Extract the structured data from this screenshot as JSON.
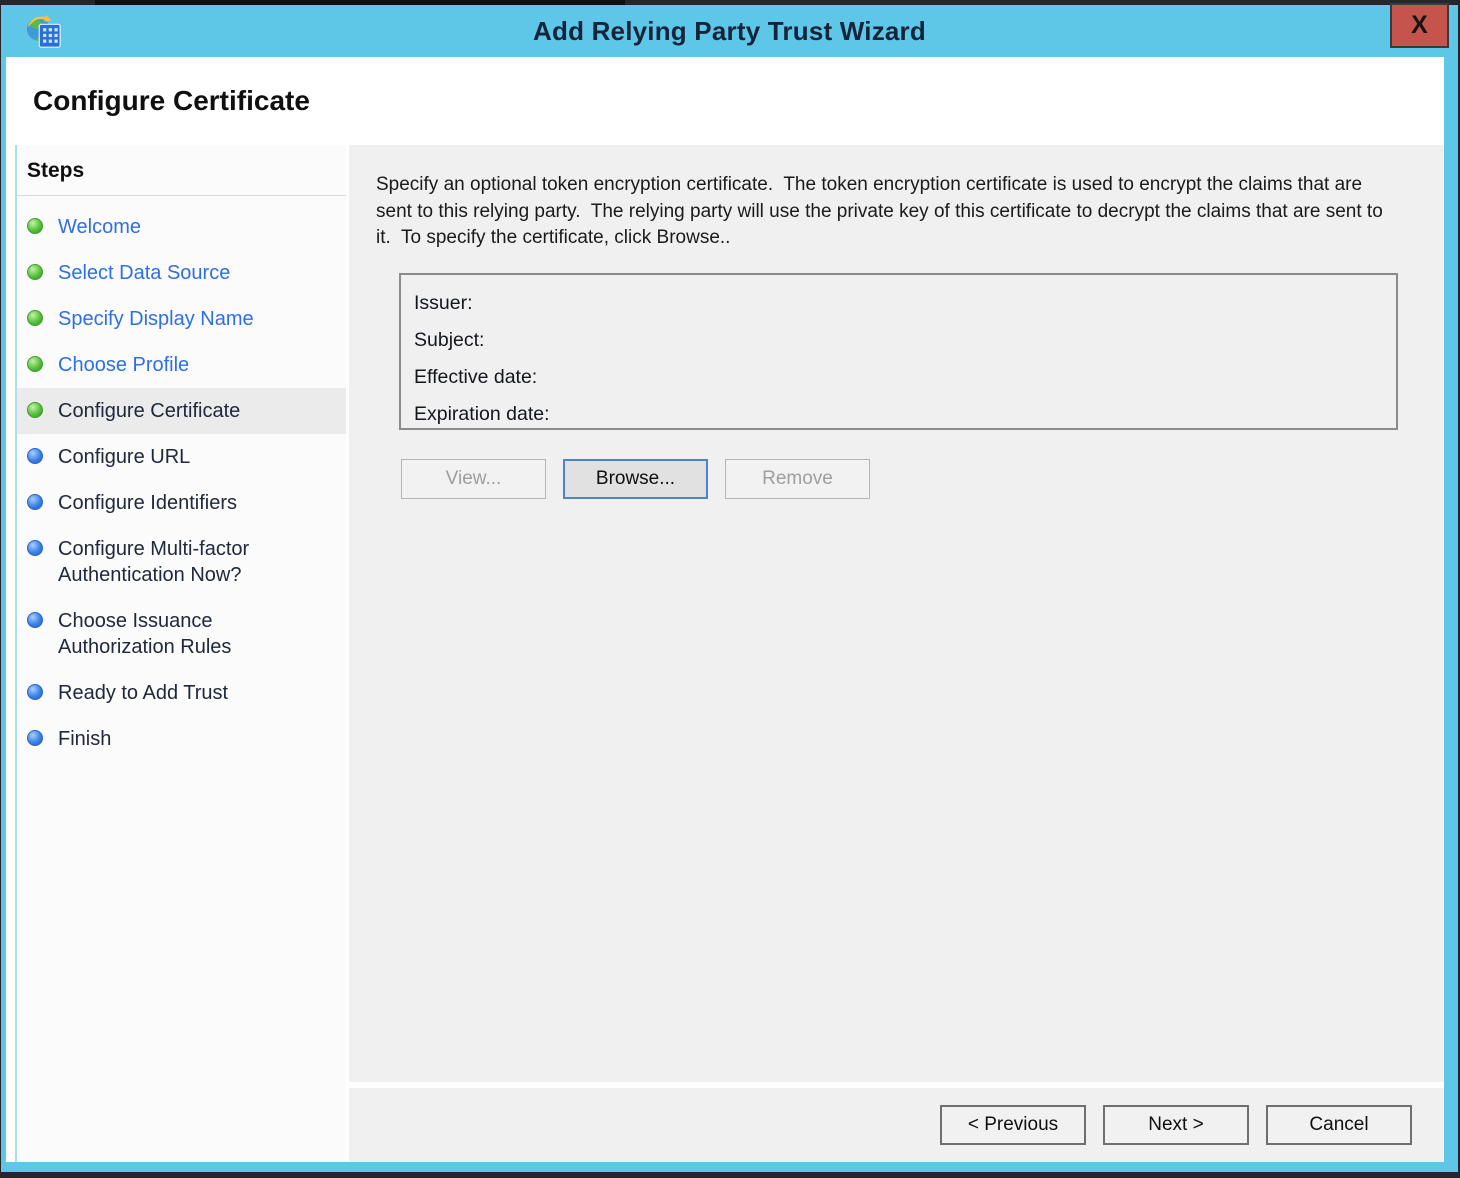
{
  "window": {
    "title": "Add Relying Party Trust Wizard",
    "close_label": "X"
  },
  "icons": {
    "app": "adfs-icon",
    "close": "close-x-icon",
    "step_completed": "green-dot-icon",
    "step_upcoming": "blue-dot-icon"
  },
  "page": {
    "title": "Configure Certificate"
  },
  "sidebar": {
    "heading": "Steps",
    "items": [
      {
        "label": "Welcome",
        "status": "completed"
      },
      {
        "label": "Select Data Source",
        "status": "completed"
      },
      {
        "label": "Specify Display Name",
        "status": "completed"
      },
      {
        "label": "Choose Profile",
        "status": "completed"
      },
      {
        "label": "Configure Certificate",
        "status": "current"
      },
      {
        "label": "Configure URL",
        "status": "upcoming"
      },
      {
        "label": "Configure Identifiers",
        "status": "upcoming"
      },
      {
        "label": "Configure Multi-factor Authentication Now?",
        "status": "upcoming"
      },
      {
        "label": "Choose Issuance Authorization Rules",
        "status": "upcoming"
      },
      {
        "label": "Ready to Add Trust",
        "status": "upcoming"
      },
      {
        "label": "Finish",
        "status": "upcoming"
      }
    ]
  },
  "content": {
    "description": "Specify an optional token encryption certificate.  The token encryption certificate is used to encrypt the claims that are sent to this relying party.  The relying party will use the private key of this certificate to decrypt the claims that are sent to it.  To specify the certificate, click Browse..",
    "certificate": {
      "fields": [
        {
          "label": "Issuer:",
          "value": ""
        },
        {
          "label": "Subject:",
          "value": ""
        },
        {
          "label": "Effective date:",
          "value": ""
        },
        {
          "label": "Expiration date:",
          "value": ""
        }
      ],
      "buttons": {
        "view": "View...",
        "browse": "Browse...",
        "remove": "Remove"
      }
    }
  },
  "footer": {
    "previous": "< Previous",
    "next": "Next >",
    "cancel": "Cancel"
  },
  "colors": {
    "titlebar": "#5EC7E8",
    "close_button": "#C5554C",
    "link_blue": "#2E6FE5",
    "completed_bullet_green": "#4CB838",
    "upcoming_bullet_blue": "#2E6FD8",
    "content_background": "#F0F0F0",
    "current_step_highlight": "#EBEBEB"
  }
}
